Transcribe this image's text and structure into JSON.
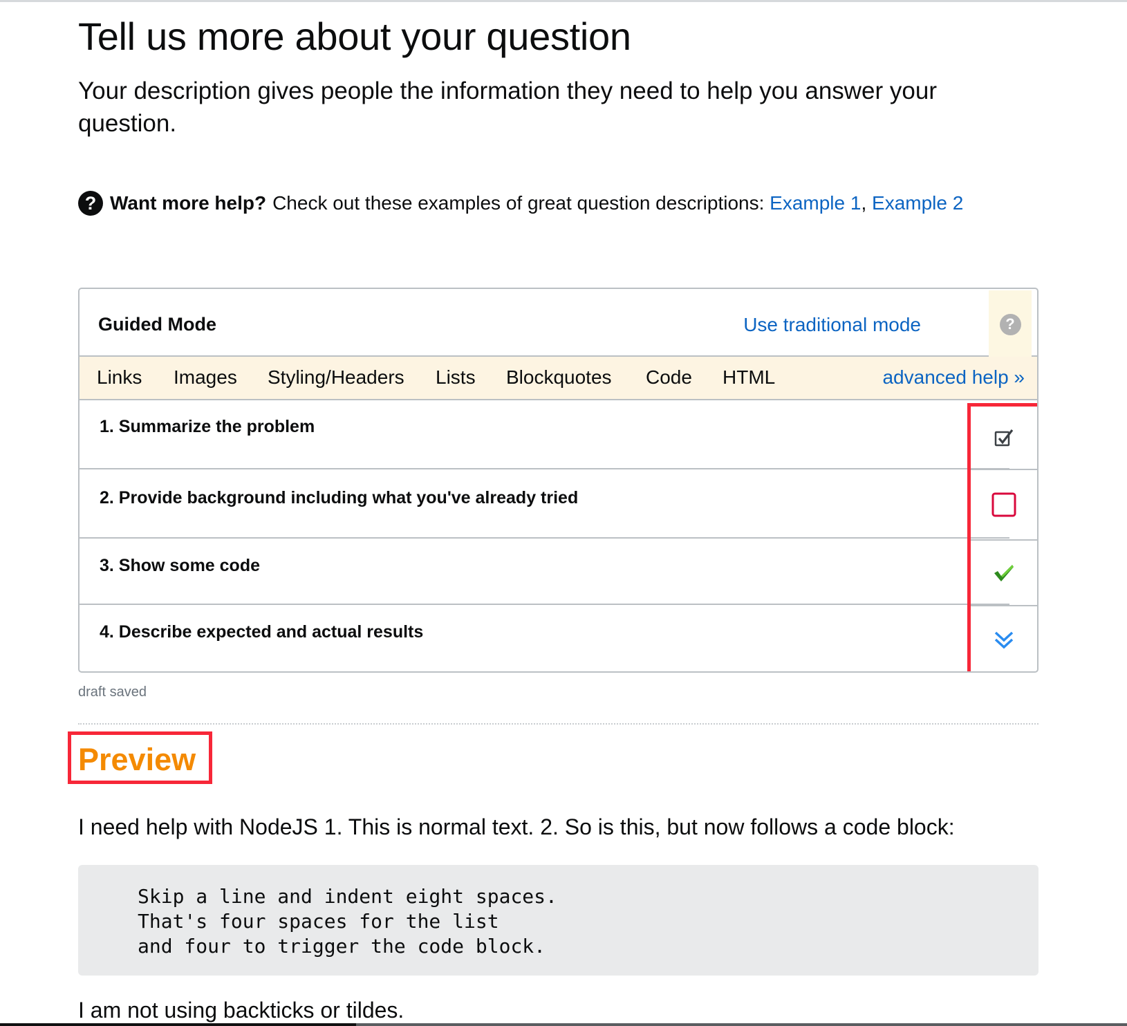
{
  "page": {
    "title": "Tell us more about your question",
    "subtitle": "Your description gives people the information they need to help you answer your question."
  },
  "help": {
    "icon": "question-circle-icon",
    "bold": "Want more help?",
    "text": "Check out these examples of great question descriptions:",
    "links": [
      "Example 1",
      "Example 2"
    ],
    "separator": ","
  },
  "guided": {
    "title": "Guided Mode",
    "traditional_link": "Use traditional mode",
    "help_icon": "question-circle-icon",
    "tabs": [
      "Links",
      "Images",
      "Styling/Headers",
      "Lists",
      "Blockquotes",
      "Code",
      "HTML"
    ],
    "advanced_help": "advanced help »",
    "steps": [
      {
        "label": "1. Summarize the problem",
        "status": "checked-box",
        "icon": "checked-checkbox-icon"
      },
      {
        "label": "2. Provide background including what you've already tried",
        "status": "empty-required",
        "icon": "empty-checkbox-icon"
      },
      {
        "label": "3. Show some code",
        "status": "complete",
        "icon": "green-checkmark-icon"
      },
      {
        "label": "4. Describe expected and actual results",
        "status": "expand",
        "icon": "double-chevron-down-icon"
      }
    ]
  },
  "draft_status": "draft saved",
  "preview": {
    "title": "Preview",
    "paragraph1": "I need help with NodeJS 1. This is normal text. 2. So is this, but now follows a code block:",
    "code_lines": [
      "Skip a line and indent eight spaces.",
      "That's four spaces for the list",
      "and four to trigger the code block."
    ],
    "paragraph2": "I am not using backticks or tildes."
  },
  "colors": {
    "link": "#0C64C2",
    "highlight_border": "#F72738",
    "preview_title": "#F48A02",
    "tabs_background": "#FDF4E2",
    "empty_checkbox": "#D9083C",
    "checkmark": "#2E8B1E",
    "chevron": "#2A8CF0"
  }
}
